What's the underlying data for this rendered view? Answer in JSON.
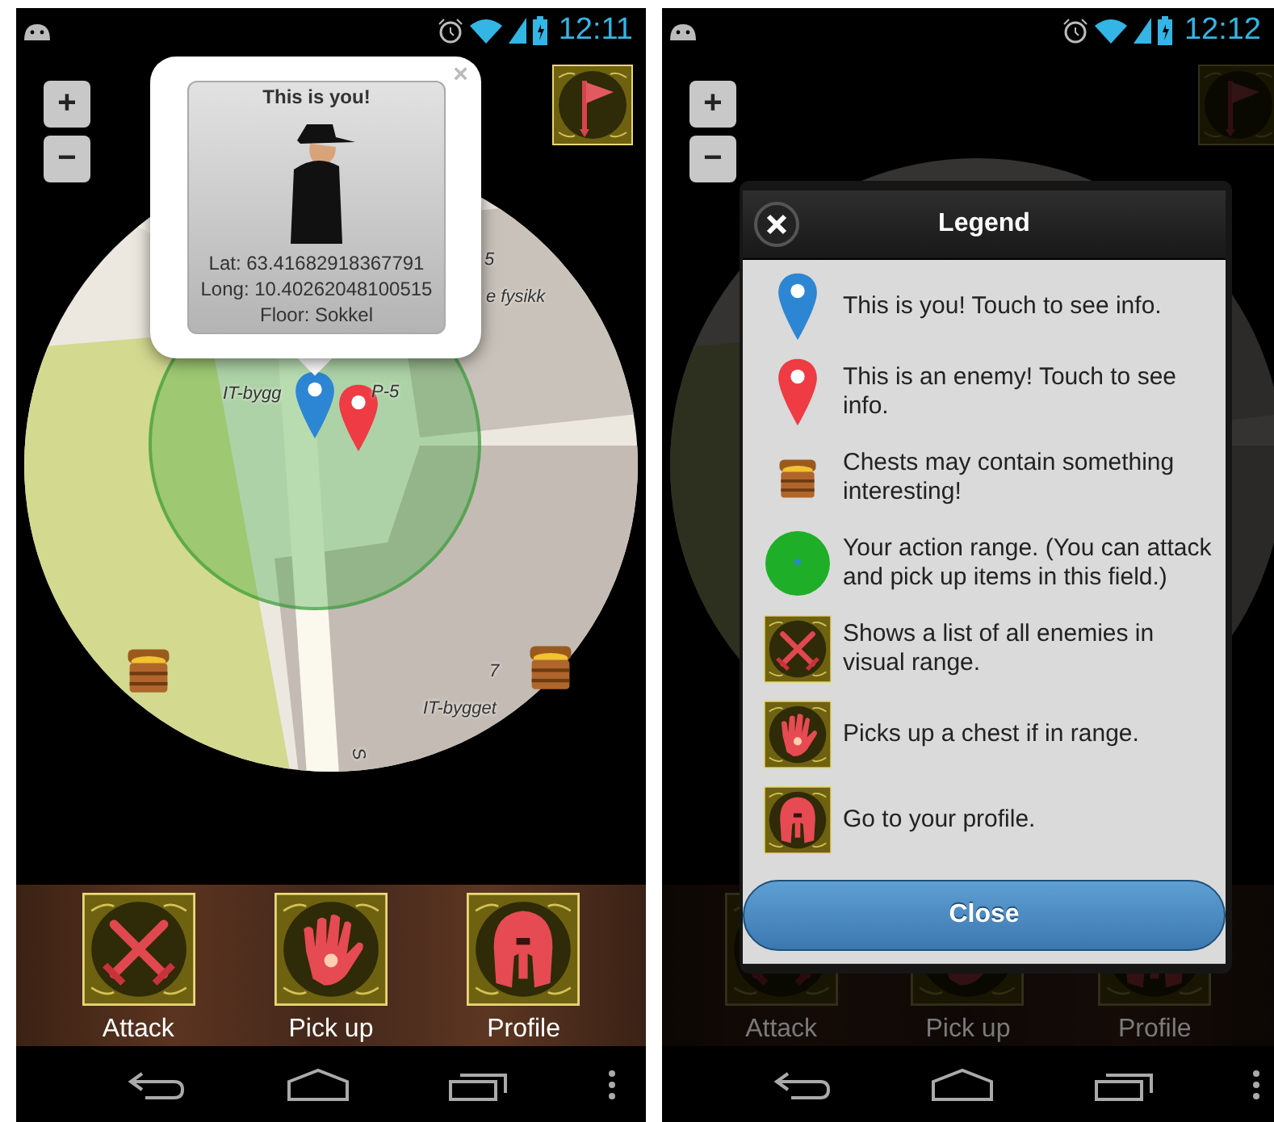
{
  "screens": [
    {
      "status_bar": {
        "time": "12:11"
      },
      "zoom_controls": [
        "+",
        "−"
      ],
      "map": {
        "labels": [
          "5",
          "e fysikk",
          "IT-bygg",
          "P-5",
          "7",
          "IT-bygget",
          "S"
        ]
      },
      "popup": {
        "close": "×",
        "title": "This is you!",
        "lines": [
          "Lat: 63.41682918367791",
          "Long: 10.40262048100515",
          "Floor: Sokkel"
        ]
      },
      "toolbar": [
        {
          "kind": "attack",
          "label": "Attack"
        },
        {
          "kind": "pickup",
          "label": "Pick up"
        },
        {
          "kind": "profile",
          "label": "Profile"
        }
      ]
    },
    {
      "status_bar": {
        "time": "12:12"
      },
      "zoom_controls": [
        "+",
        "−"
      ],
      "dialog": {
        "title": "Legend",
        "items": [
          {
            "kind": "blue-pin",
            "text": "This is you! Touch to see info."
          },
          {
            "kind": "red-pin",
            "text": "This is an enemy! Touch to see info."
          },
          {
            "kind": "chest",
            "text": "Chests may contain something interesting!"
          },
          {
            "kind": "range",
            "text": "Your action range. (You can attack and pick up items in this field.)"
          },
          {
            "kind": "attack",
            "text": "Shows a list of all enemies in visual range."
          },
          {
            "kind": "pickup",
            "text": "Picks up a chest if in range."
          },
          {
            "kind": "profile",
            "text": "Go to your profile."
          }
        ],
        "button": "Close"
      },
      "toolbar": [
        {
          "kind": "attack",
          "label": "Attack"
        },
        {
          "kind": "pickup",
          "label": "Pick up"
        },
        {
          "kind": "profile",
          "label": "Profile"
        }
      ]
    }
  ]
}
